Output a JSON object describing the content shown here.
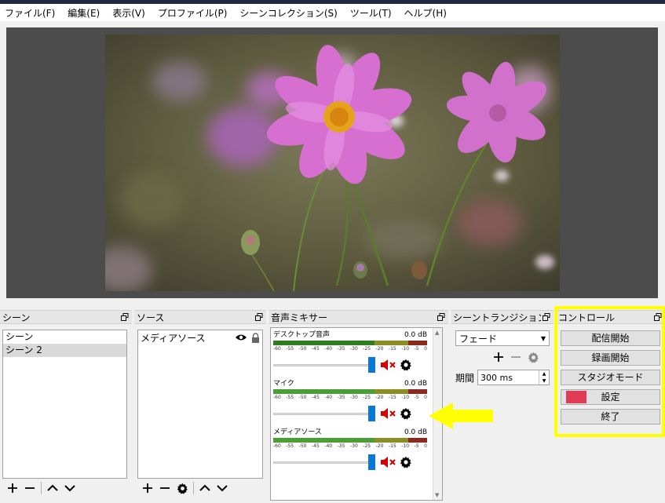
{
  "menubar": {
    "items": [
      {
        "id": "file",
        "label": "ファイル(F)"
      },
      {
        "id": "edit",
        "label": "編集(E)"
      },
      {
        "id": "view",
        "label": "表示(V)"
      },
      {
        "id": "profile",
        "label": "プロファイル(P)"
      },
      {
        "id": "scene-collection",
        "label": "シーンコレクション(S)"
      },
      {
        "id": "tools",
        "label": "ツール(T)"
      },
      {
        "id": "help",
        "label": "ヘルプ(H)"
      }
    ]
  },
  "preview": {
    "content": "pink cosmos flowers photo"
  },
  "scenes": {
    "title": "シーン",
    "items": [
      "シーン",
      "シーン 2"
    ],
    "selected_index": 1
  },
  "sources": {
    "title": "ソース",
    "items": [
      {
        "label": "メディアソース",
        "visible": true,
        "locked": true
      }
    ]
  },
  "mixer": {
    "title": "音声ミキサー",
    "ticks": [
      "-60",
      "-55",
      "-50",
      "-45",
      "-40",
      "-35",
      "-30",
      "-25",
      "-20",
      "-15",
      "-10",
      "-5",
      "0"
    ],
    "channels": [
      {
        "name": "デスクトップ音声",
        "db": "0.0 dB",
        "volume": 1.0,
        "muted": true
      },
      {
        "name": "マイク",
        "db": "0.0 dB",
        "volume": 1.0,
        "muted": true
      },
      {
        "name": "メディアソース",
        "db": "0.0 dB",
        "volume": 1.0,
        "muted": true
      }
    ]
  },
  "transitions": {
    "title": "シーントランジション",
    "selected": "フェード",
    "duration_label": "期間",
    "duration_value": "300 ms"
  },
  "controls": {
    "title": "コントロール",
    "start_streaming": "配信開始",
    "start_recording": "録画開始",
    "studio_mode": "スタジオモード",
    "settings": "設定",
    "exit": "終了"
  },
  "colors": {
    "accent_blue": "#0a78d7",
    "mute_red": "#d40000",
    "highlight_yellow": "#ffff00",
    "settings_marker": "#e01e3c"
  },
  "icons": {
    "add": "plus-icon",
    "remove": "minus-icon",
    "up": "chevron-up-icon",
    "down": "chevron-down-icon",
    "gear": "gear-icon",
    "eye": "eye-icon",
    "lock": "lock-icon",
    "mute": "speaker-muted-icon",
    "float": "float-window-icon"
  }
}
